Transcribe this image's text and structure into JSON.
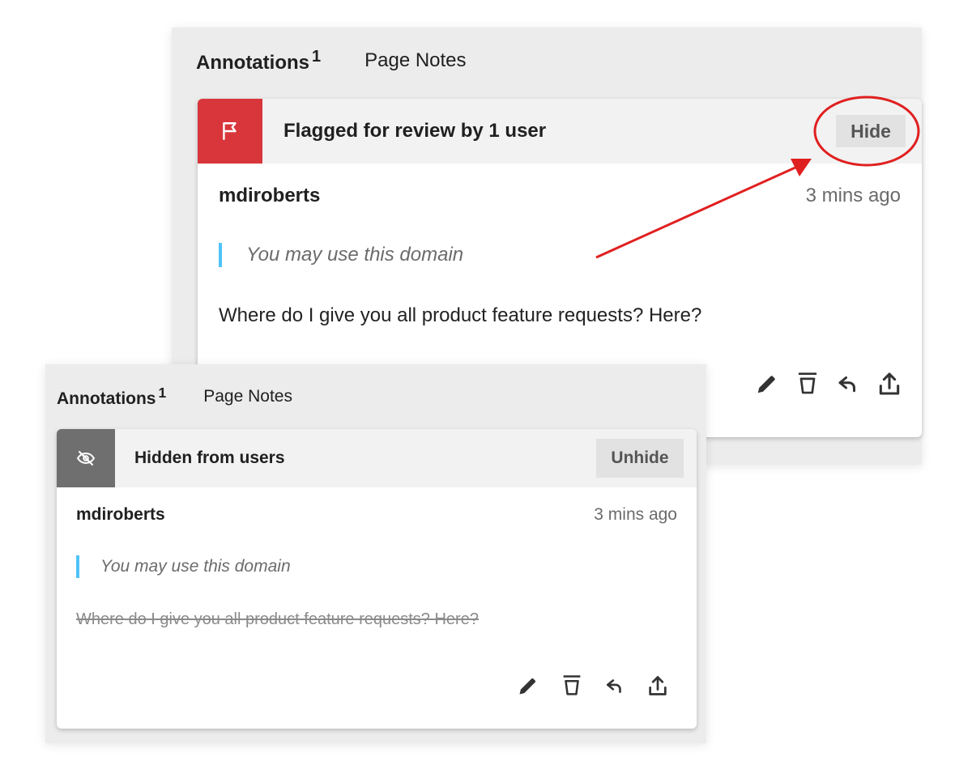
{
  "colors": {
    "flag_red": "#d8363b",
    "hidden_grey": "#6f6f6f",
    "quote_bar": "#4fc3f7",
    "callout_red": "#e02020"
  },
  "top_panel": {
    "tabs": {
      "annotations_label": "Annotations",
      "annotations_count": "1",
      "page_notes_label": "Page Notes"
    },
    "banner": {
      "icon": "flag-icon",
      "text": "Flagged for review by 1 user",
      "button_label": "Hide"
    },
    "annotation": {
      "username": "mdiroberts",
      "timestamp": "3 mins ago",
      "quote": "You may use this domain",
      "body": "Where do I give you all product feature requests? Here?"
    },
    "actions": [
      "edit-icon",
      "delete-icon",
      "reply-icon",
      "share-icon"
    ]
  },
  "bottom_panel": {
    "tabs": {
      "annotations_label": "Annotations",
      "annotations_count": "1",
      "page_notes_label": "Page Notes"
    },
    "banner": {
      "icon": "eye-slash-icon",
      "text": "Hidden from users",
      "button_label": "Unhide"
    },
    "annotation": {
      "username": "mdiroberts",
      "timestamp": "3 mins ago",
      "quote": "You may use this domain",
      "body": "Where do I give you all product feature requests? Here?"
    },
    "actions": [
      "edit-icon",
      "delete-icon",
      "reply-icon",
      "share-icon"
    ]
  }
}
